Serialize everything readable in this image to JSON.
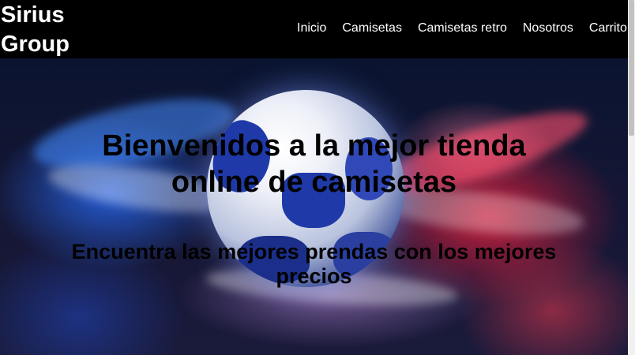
{
  "header": {
    "logo_line1": "Sirius",
    "logo_line2": "Group",
    "nav": [
      {
        "label": "Inicio"
      },
      {
        "label": "Camisetas"
      },
      {
        "label": "Camisetas retro"
      },
      {
        "label": "Nosotros"
      },
      {
        "label": "Carrito"
      }
    ]
  },
  "hero": {
    "title_line1": "Bienvenidos a la mejor tienda",
    "title_line2": "online de camisetas",
    "subtitle_line1": "Encuentra las mejores prendas con los mejores",
    "subtitle_line2": "precios"
  },
  "colors": {
    "header_bg": "#000000",
    "header_text": "#ffffff",
    "hero_text": "#000000"
  }
}
